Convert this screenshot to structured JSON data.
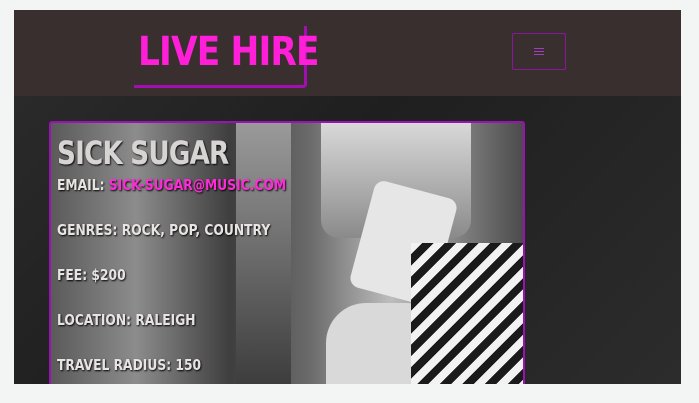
{
  "header": {
    "logo_text": "LIVE HIRE",
    "menu_icon": "hamburger-icon"
  },
  "artist": {
    "name": "SICK SUGAR",
    "email_label": "EMAIL:",
    "email": "SICK-SUGAR@MUSIC.COM",
    "genres_label": "GENRES:",
    "genres": "ROCK, POP, COUNTRY",
    "fee_label": "FEE:",
    "fee": "$200",
    "location_label": "LOCATION:",
    "location": "RALEIGH",
    "travel_label": "TRAVEL RADIUS:",
    "travel": "150"
  },
  "colors": {
    "navbar_bg": "#3a2f2f",
    "accent": "#ff1fd8",
    "border": "#9a12b3"
  }
}
